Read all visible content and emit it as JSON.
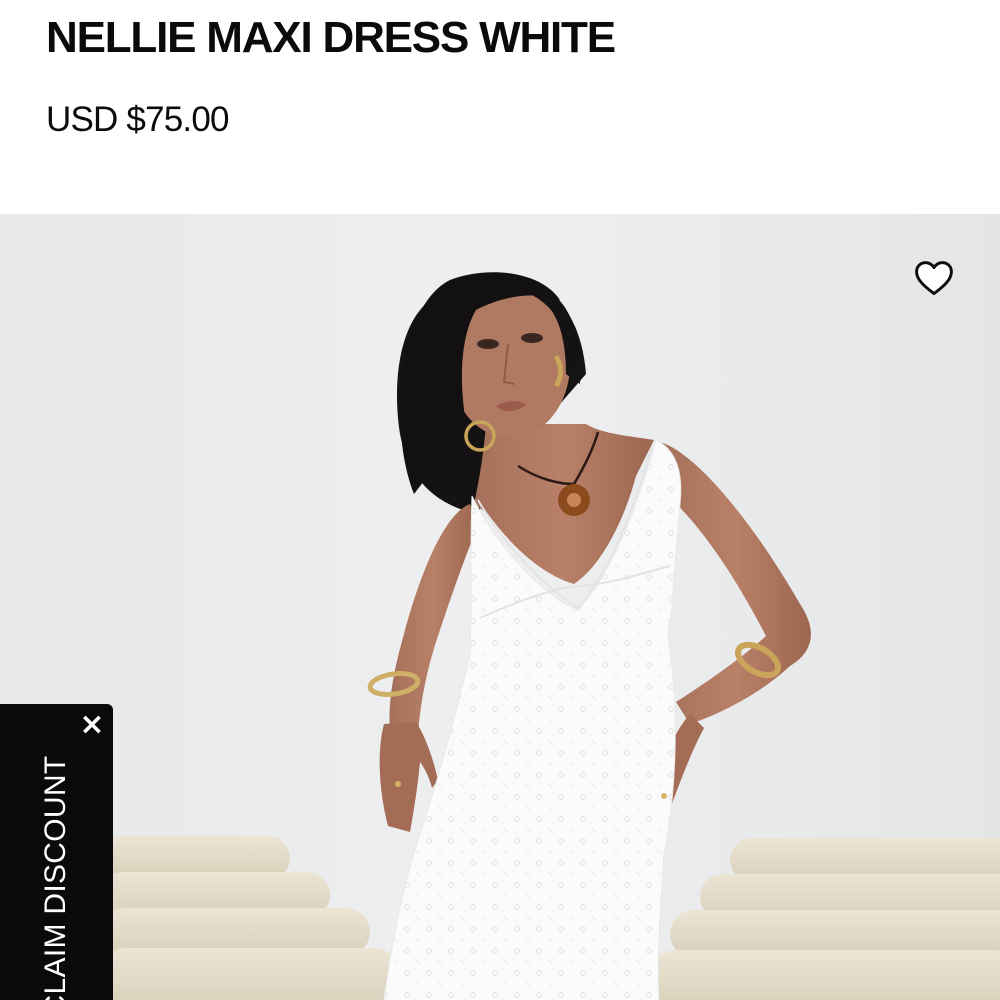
{
  "product": {
    "title": "NELLIE MAXI DRESS WHITE",
    "price": "USD $75.00"
  },
  "gallery": {
    "image_alt": "Model wearing the white maxi dress",
    "wishlist_icon": "heart-outline-icon"
  },
  "promo": {
    "label": "CLAIM DISCOUNT",
    "close_label": "×"
  },
  "colors": {
    "text": "#0b0b0b",
    "promo_background": "#0a0a0a",
    "hero_background": "#e9eaec"
  }
}
